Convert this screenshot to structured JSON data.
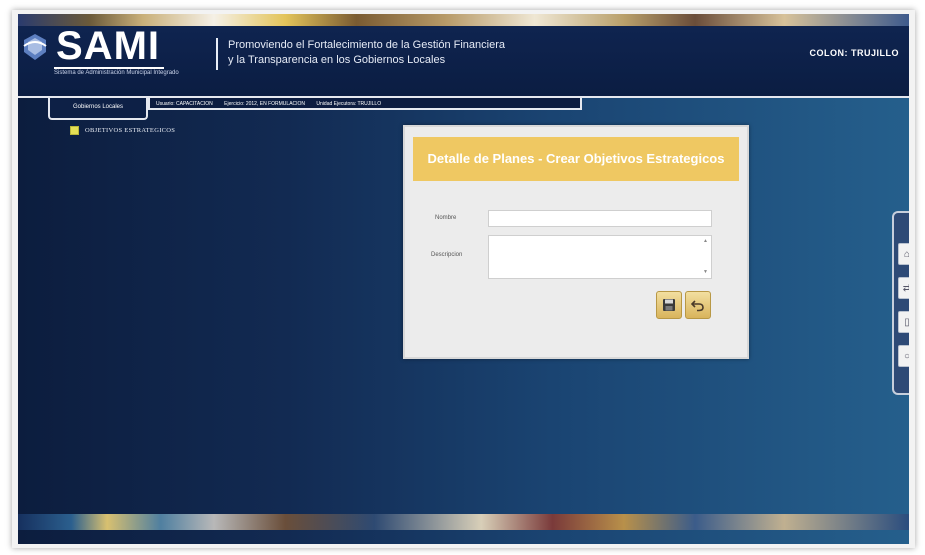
{
  "header": {
    "logo_text": "SAMI",
    "logo_subtitle": "Sistema de Administración Municipal Integrado",
    "tagline_line1": "Promoviendo el Fortalecimiento de la Gestión Financiera",
    "tagline_line2": "y la Transparencia en los Gobiernos Locales",
    "city": "COLON: TRUJILLO"
  },
  "nav": {
    "tab_label": "Gobiernos Locales",
    "user": "Usuario: CAPACITACION",
    "exercise": "Ejercicio: 2012, EN FORMULACION",
    "unit": "Unidad Ejecutora: TRUJILLO"
  },
  "tree": {
    "item_label": "OBJETIVOS ESTRATEGICOS"
  },
  "dialog": {
    "title": "Detalle de Planes - Crear Objetivos Estrategicos",
    "nombre_label": "Nombre",
    "nombre_value": "",
    "descripcion_label": "Descripcion",
    "descripcion_value": "",
    "save_icon": "floppy-disk-icon",
    "back_icon": "undo-arrow-icon"
  },
  "side_panel": {
    "icons": [
      "home-icon",
      "exchange-icon",
      "document-icon",
      "help-icon"
    ]
  },
  "colors": {
    "header_bg": "#0f2450",
    "dialog_title_bg": "#efc862",
    "tree_bullet": "#e4df55"
  }
}
